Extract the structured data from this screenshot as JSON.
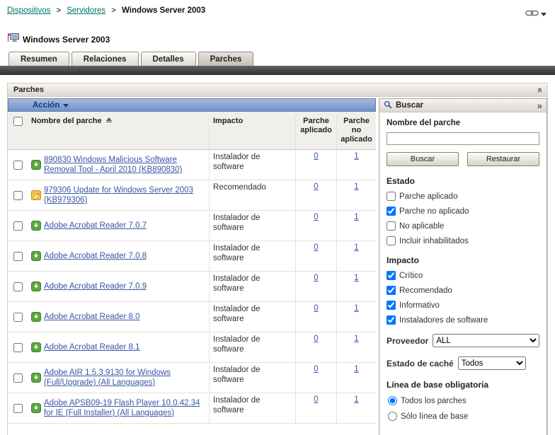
{
  "colors": {
    "breadcrumb_link": "#007468",
    "patch_link": "#3a55a4",
    "action_bar": "#7190c5",
    "action_bar_text": "#14387f",
    "installer_icon_green": "#5aa83d",
    "recommended_icon_orange": "#f5c242"
  },
  "breadcrumb": {
    "separator": ">",
    "items": [
      {
        "label": "Dispositivos"
      },
      {
        "label": "Servidores"
      },
      {
        "label": "Windows Server 2003"
      }
    ]
  },
  "page": {
    "title": "Windows Server 2003"
  },
  "tabs": [
    {
      "label": "Resumen"
    },
    {
      "label": "Relaciones"
    },
    {
      "label": "Detalles"
    },
    {
      "label": "Parches",
      "active": true
    }
  ],
  "panel": {
    "title": "Parches"
  },
  "action_bar": {
    "label": "Acción"
  },
  "table": {
    "headers": {
      "name": "Nombre del parche",
      "impact": "Impacto",
      "applied": "Parche aplicado",
      "not_applied": "Parche no aplicado"
    },
    "rows": [
      {
        "icon": "software-installer",
        "name": "890830 Windows Malicious Software Removal Tool - April 2010 (KB890830)",
        "impact": "Instalador de software",
        "applied": "0",
        "not_applied": "1"
      },
      {
        "icon": "recommended",
        "name": "979306 Update for Windows Server 2003 (KB979306)",
        "impact": "Recomendado",
        "applied": "0",
        "not_applied": "1"
      },
      {
        "icon": "software-installer",
        "name": "Adobe Acrobat Reader 7.0.7",
        "impact": "Instalador de software",
        "applied": "0",
        "not_applied": "1"
      },
      {
        "icon": "software-installer",
        "name": "Adobe Acrobat Reader 7.0.8",
        "impact": "Instalador de software",
        "applied": "0",
        "not_applied": "1"
      },
      {
        "icon": "software-installer",
        "name": "Adobe Acrobat Reader 7.0.9",
        "impact": "Instalador de software",
        "applied": "0",
        "not_applied": "1"
      },
      {
        "icon": "software-installer",
        "name": "Adobe Acrobat Reader 8.0",
        "impact": "Instalador de software",
        "applied": "0",
        "not_applied": "1"
      },
      {
        "icon": "software-installer",
        "name": "Adobe Acrobat Reader 8.1",
        "impact": "Instalador de software",
        "applied": "0",
        "not_applied": "1"
      },
      {
        "icon": "software-installer",
        "name": "Adobe AIR 1.5.3.9130 for Windows (Full/Upgrade) (All Languages)",
        "impact": "Instalador de software",
        "applied": "0",
        "not_applied": "1"
      },
      {
        "icon": "software-installer",
        "name": "Adobe APSB09-19 Flash Player 10.0.42.34 for IE (Full Installer) (All Languages)",
        "impact": "Instalador de software",
        "applied": "0",
        "not_applied": "1"
      }
    ]
  },
  "search": {
    "title": "Buscar",
    "name_label": "Nombre del parche",
    "name_value": "",
    "search_button": "Buscar",
    "reset_button": "Restaurar",
    "estado": {
      "label": "Estado",
      "options": [
        {
          "label": "Parche aplicado",
          "checked": false
        },
        {
          "label": "Parche no aplicado",
          "checked": true
        },
        {
          "label": "No aplicable",
          "checked": false
        },
        {
          "label": "Incluir inhabilitados",
          "checked": false
        }
      ]
    },
    "impacto": {
      "label": "Impacto",
      "options": [
        {
          "label": "Crítico",
          "checked": true
        },
        {
          "label": "Recomendado",
          "checked": true
        },
        {
          "label": "Informativo",
          "checked": true
        },
        {
          "label": "Instaladores de software",
          "checked": true
        }
      ]
    },
    "proveedor": {
      "label": "Proveedor",
      "value": "ALL"
    },
    "cache": {
      "label": "Estado de caché",
      "value": "Todos"
    },
    "baseline": {
      "label": "Línea de base obligatoria",
      "options": [
        {
          "label": "Todos los parches",
          "selected": true
        },
        {
          "label": "Sólo línea de base",
          "selected": false
        }
      ]
    }
  }
}
